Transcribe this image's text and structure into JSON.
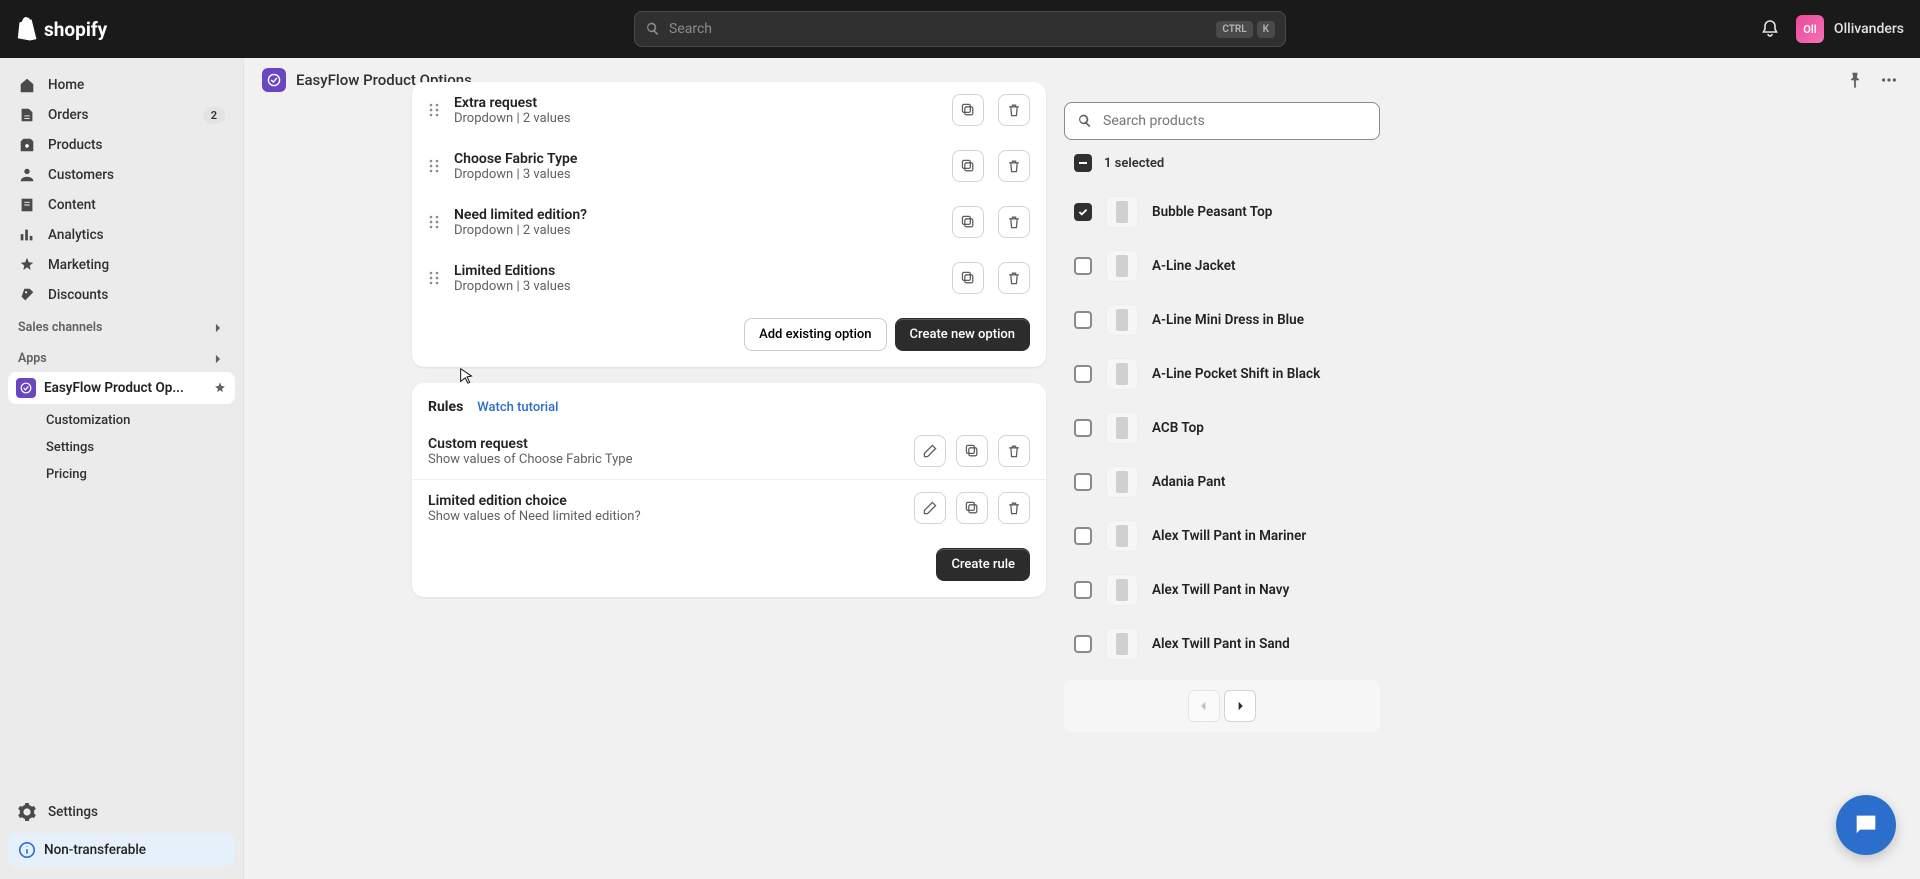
{
  "topbar": {
    "search_placeholder": "Search",
    "kbd1": "CTRL",
    "kbd2": "K",
    "user": "Ollivanders",
    "avatar_initials": "Oll"
  },
  "sidebar": {
    "nav": [
      {
        "label": "Home"
      },
      {
        "label": "Orders",
        "badge": "2"
      },
      {
        "label": "Products"
      },
      {
        "label": "Customers"
      },
      {
        "label": "Content"
      },
      {
        "label": "Analytics"
      },
      {
        "label": "Marketing"
      },
      {
        "label": "Discounts"
      }
    ],
    "channels_heading": "Sales channels",
    "apps_heading": "Apps",
    "active_app": "EasyFlow Product Op...",
    "sub": [
      "Customization",
      "Settings",
      "Pricing"
    ],
    "settings": "Settings",
    "banner": "Non-transferable"
  },
  "header": {
    "app": "EasyFlow Product Options"
  },
  "options": [
    {
      "title": "Extra request",
      "meta": "Dropdown | 2 values"
    },
    {
      "title": "Choose Fabric Type",
      "meta": "Dropdown | 3 values"
    },
    {
      "title": "Need limited edition?",
      "meta": "Dropdown | 2 values"
    },
    {
      "title": "Limited Editions",
      "meta": "Dropdown | 3 values"
    }
  ],
  "buttons": {
    "add_existing": "Add existing option",
    "create_option": "Create new option",
    "create_rule": "Create rule"
  },
  "rules_panel": {
    "title": "Rules",
    "tutorial": "Watch tutorial"
  },
  "rules": [
    {
      "title": "Custom request",
      "meta": "Show values of Choose Fabric Type"
    },
    {
      "title": "Limited edition choice",
      "meta": "Show values of Need limited edition?"
    }
  ],
  "products_panel": {
    "search_placeholder": "Search products",
    "selected_text": "1 selected"
  },
  "products": [
    {
      "name": "Bubble Peasant Top",
      "checked": true
    },
    {
      "name": "A-Line Jacket",
      "checked": false
    },
    {
      "name": "A-Line Mini Dress in Blue",
      "checked": false
    },
    {
      "name": "A-Line Pocket Shift in Black",
      "checked": false
    },
    {
      "name": "ACB Top",
      "checked": false
    },
    {
      "name": "Adania Pant",
      "checked": false
    },
    {
      "name": "Alex Twill Pant in Mariner",
      "checked": false
    },
    {
      "name": "Alex Twill Pant in Navy",
      "checked": false
    },
    {
      "name": "Alex Twill Pant in Sand",
      "checked": false
    }
  ]
}
